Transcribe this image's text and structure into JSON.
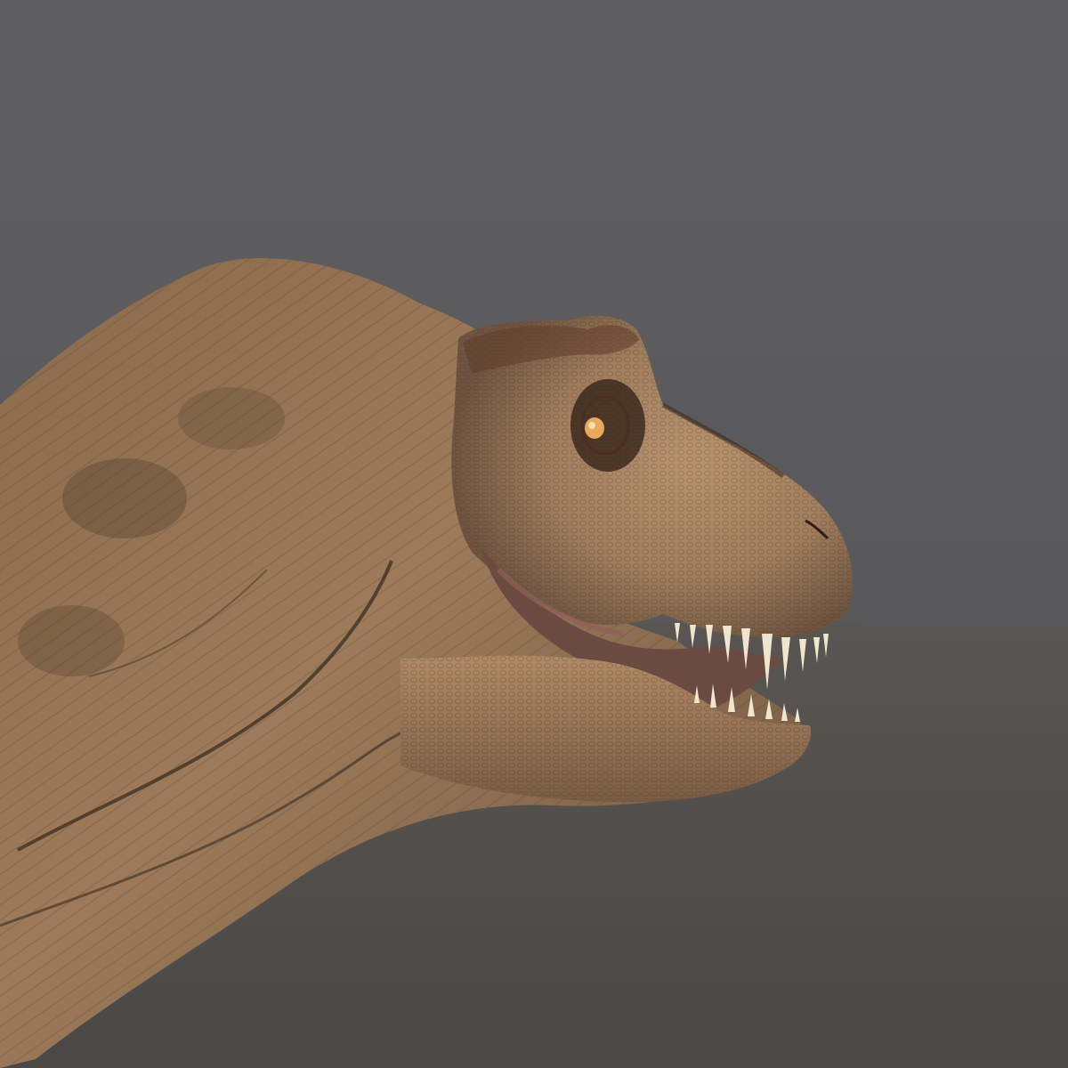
{
  "scene": {
    "subject": "t-rex-head-render",
    "colors": {
      "backdrop_top": "#5f5f61",
      "backdrop_bottom": "#545456",
      "floor_far": "#585552",
      "floor_near": "#4a4846",
      "skin_light": "#b08a66",
      "skin_mid": "#8a6a4c",
      "skin_dark": "#5e4733",
      "crease": "#3a2c20",
      "mouth": "#6b4a42",
      "gum": "#8e6058",
      "tooth": "#efe6cf",
      "eye": "#e8a95a",
      "eye_socket": "#2d1e16"
    }
  }
}
